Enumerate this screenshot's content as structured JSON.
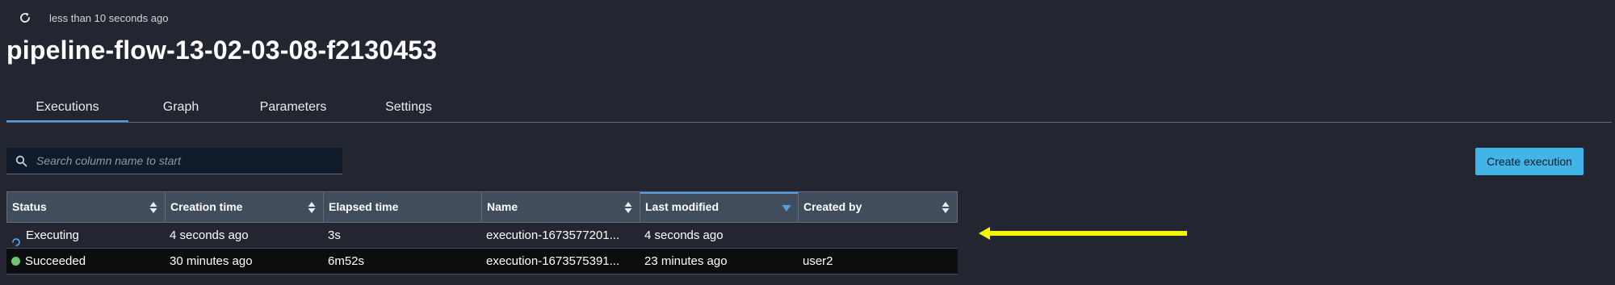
{
  "header": {
    "refresh_text": "less than 10 seconds ago",
    "title": "pipeline-flow-13-02-03-08-f2130453"
  },
  "tabs": [
    {
      "label": "Executions",
      "active": true
    },
    {
      "label": "Graph",
      "active": false
    },
    {
      "label": "Parameters",
      "active": false
    },
    {
      "label": "Settings",
      "active": false
    }
  ],
  "search": {
    "placeholder": "Search column name to start",
    "value": ""
  },
  "create_button": {
    "label": "Create execution"
  },
  "table": {
    "columns": [
      "Status",
      "Creation time",
      "Elapsed time",
      "Name",
      "Last modified",
      "Created by"
    ],
    "sorted_column": "Last modified",
    "sort_direction": "descending",
    "rows": [
      {
        "status": "Executing",
        "creation_time": "4 seconds ago",
        "elapsed_time": "3s",
        "name": "execution-1673577201...",
        "last_modified": "4 seconds ago",
        "created_by": ""
      },
      {
        "status": "Succeeded",
        "creation_time": "30 minutes ago",
        "elapsed_time": "6m52s",
        "name": "execution-1673575391...",
        "last_modified": "23 minutes ago",
        "created_by": "user2"
      }
    ]
  },
  "colors": {
    "background": "#232631",
    "accent": "#539fe5",
    "button": "#41b4e8",
    "success": "#6ec66e",
    "annotation_arrow": "#f5f500"
  }
}
